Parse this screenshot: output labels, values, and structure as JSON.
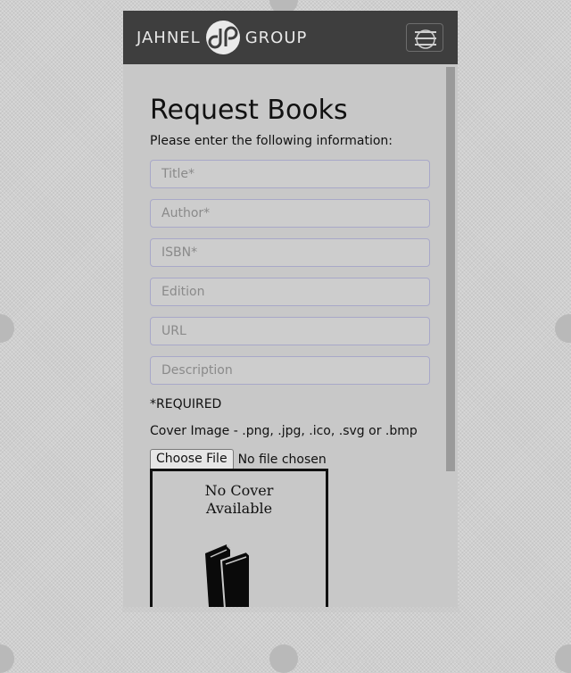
{
  "header": {
    "brand_left": "JAHNEL",
    "brand_right": "GROUP",
    "logo_icon": "jg-logo-mark",
    "menu_icon": "hamburger-menu-icon"
  },
  "form": {
    "title": "Request Books",
    "intro": "Please enter the following information:",
    "fields": {
      "title_placeholder": "Title*",
      "author_placeholder": "Author*",
      "isbn_placeholder": "ISBN*",
      "edition_placeholder": "Edition",
      "url_placeholder": "URL",
      "description_placeholder": "Description"
    },
    "required_note": "*REQUIRED",
    "cover_label": "Cover Image - .png, .jpg, .ico, .svg or .bmp",
    "choose_file_label": "Choose File",
    "no_file_text": "No file chosen",
    "cover_placeholder_line1": "No Cover",
    "cover_placeholder_line2": "Available",
    "cover_icon": "books-icon"
  },
  "colors": {
    "navbar": "#3e3e3e",
    "page_background": "#c8c8c8",
    "field_border": "#a8a8c8"
  }
}
